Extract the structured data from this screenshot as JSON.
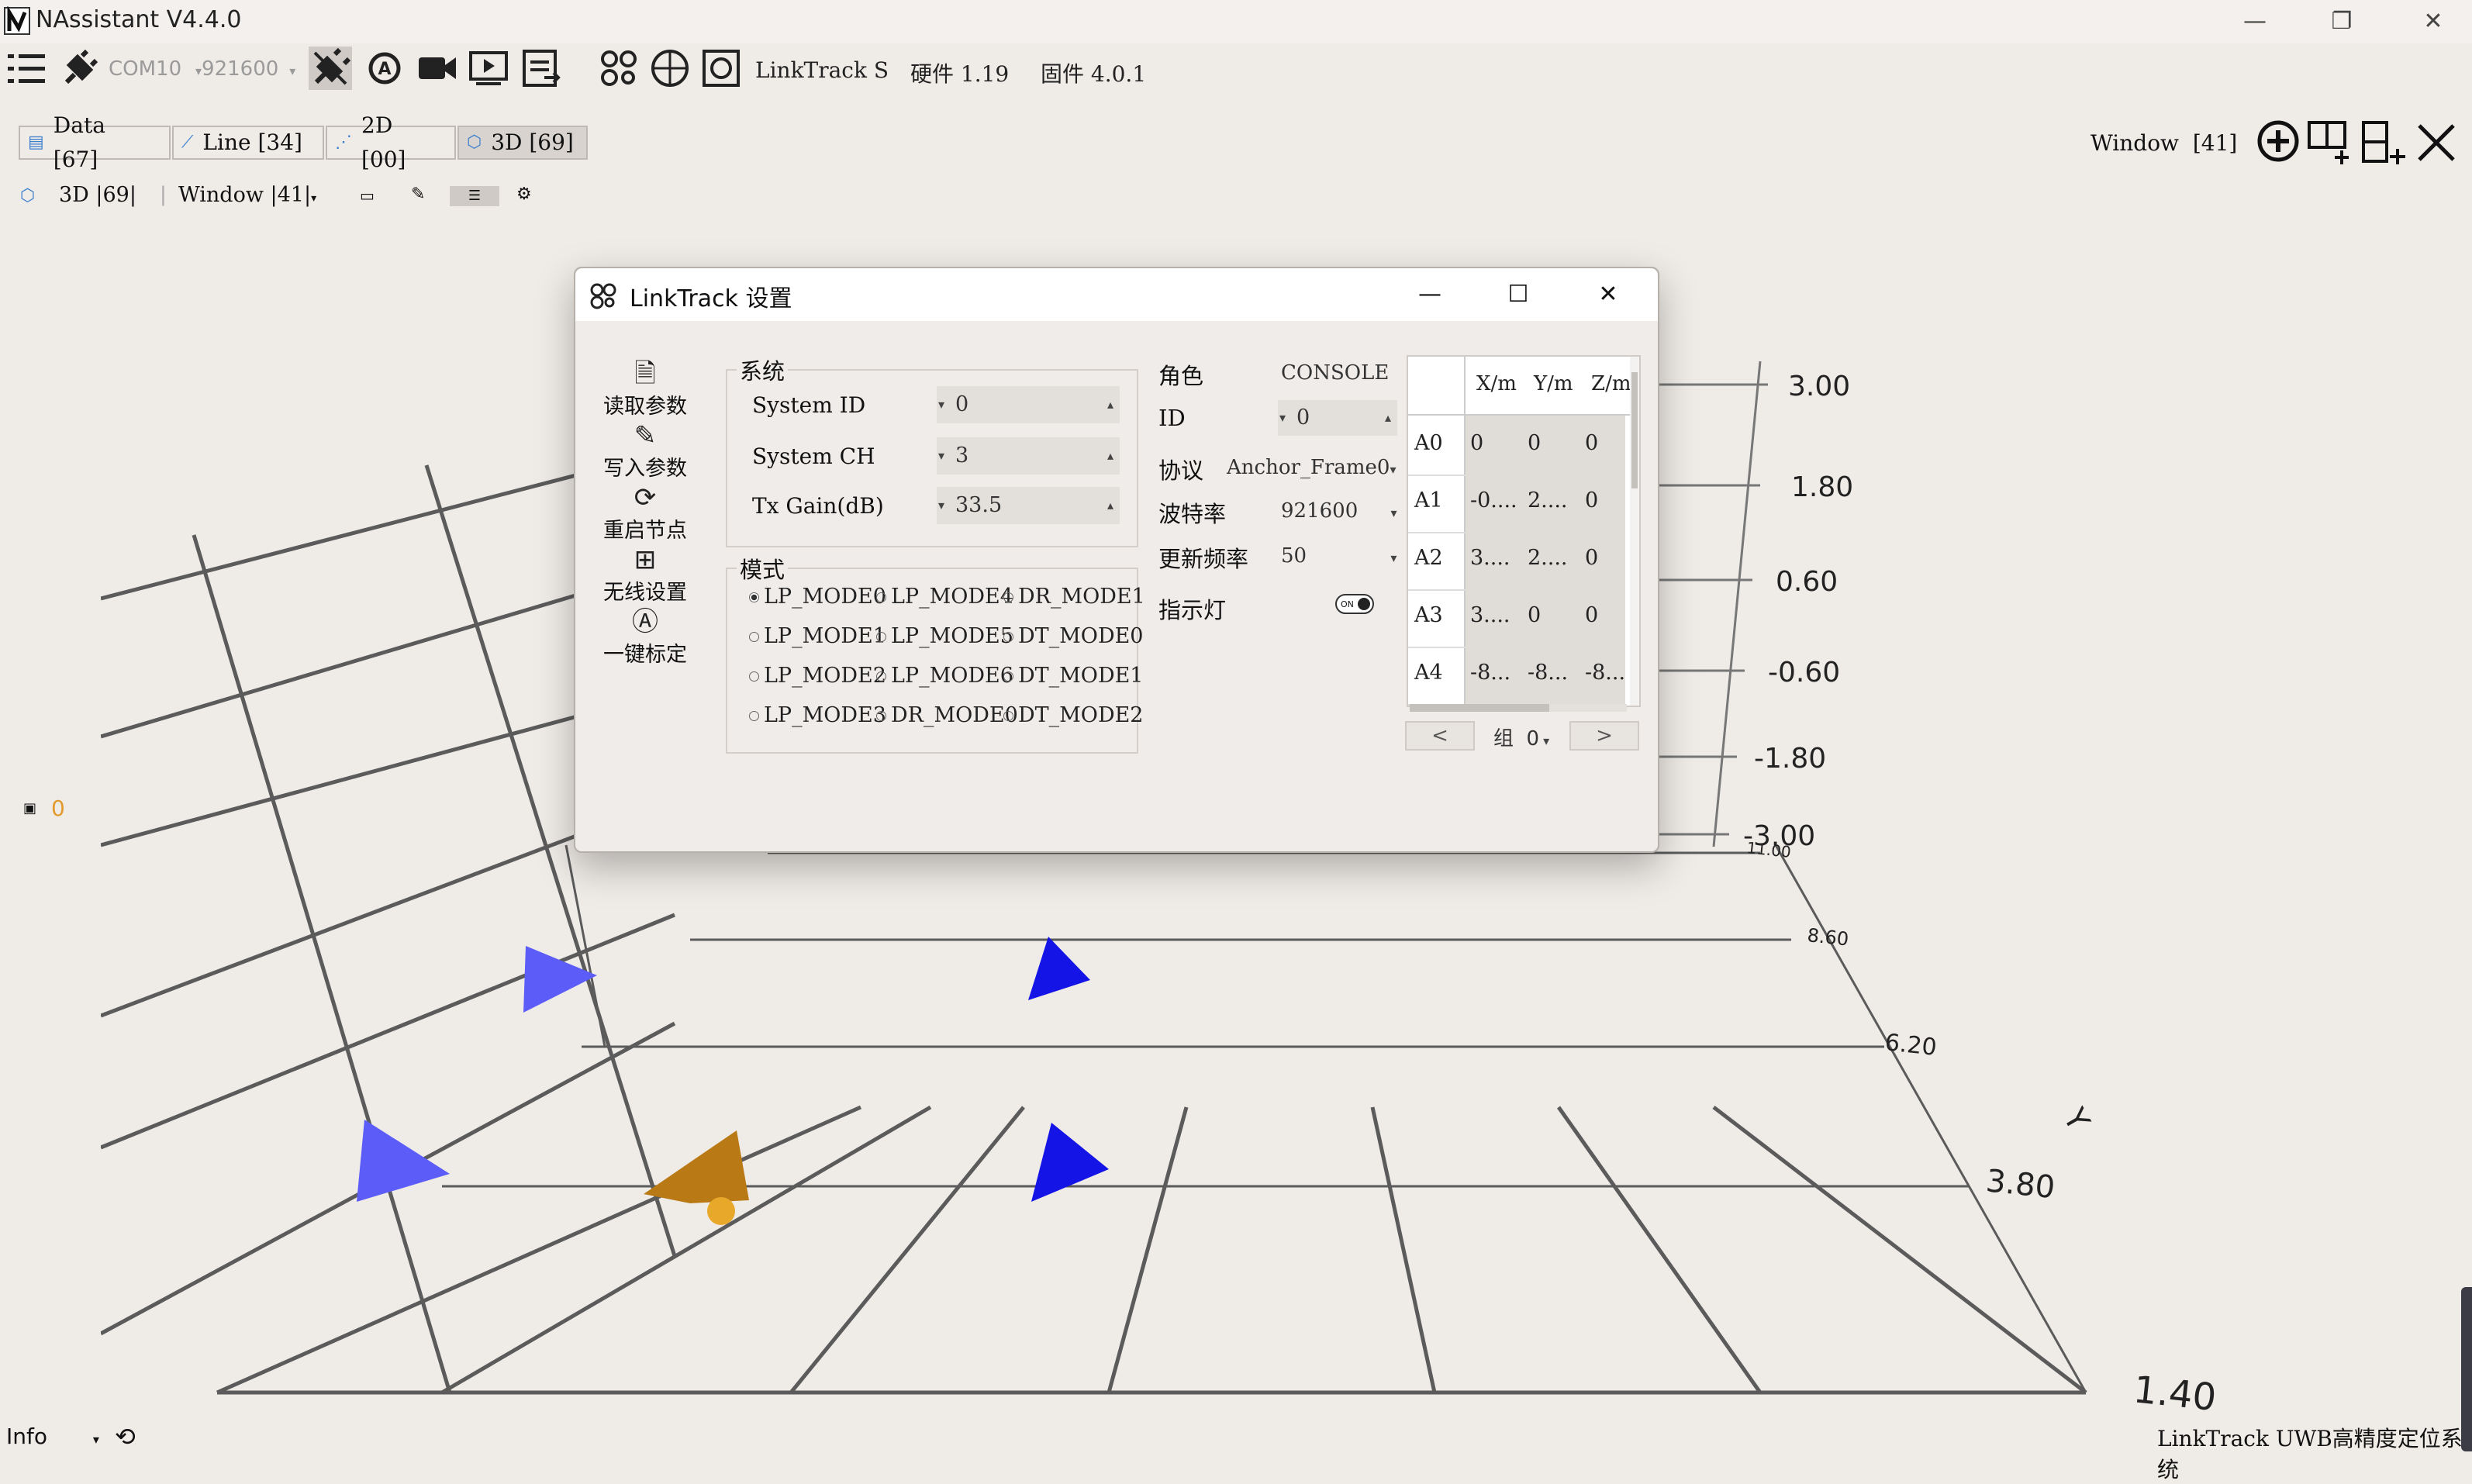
{
  "window": {
    "title": "NAssistant V4.4.0",
    "minimize": "—",
    "restore": "❐",
    "close": "✕"
  },
  "toolbar": {
    "port": "COM10",
    "baud": "921600",
    "device": "LinkTrack S",
    "hardware": "硬件 1.19",
    "firmware": "固件 4.0.1"
  },
  "tabs": [
    {
      "label": "Data [67]"
    },
    {
      "label": "Line [34]"
    },
    {
      "label": "2D [00]"
    },
    {
      "label": "3D [69]"
    }
  ],
  "window_selector": {
    "label": "Window",
    "value": "[41]"
  },
  "subtoolbar": {
    "view": "3D |69|",
    "window": "Window |41|"
  },
  "legend": {
    "tag": "0",
    "tag_color": "#e39a2e"
  },
  "plot3d": {
    "z_ticks": [
      "3.00",
      "1.80",
      "0.60",
      "-0.60",
      "-1.80",
      "-3.00"
    ],
    "y_ticks": [
      "11.00",
      "8.60",
      "6.20",
      "3.80",
      "1.40"
    ],
    "y_axis_label": "Y",
    "anchor_color": "#4a4df5",
    "tag_color": "#c8841a"
  },
  "dialog": {
    "title": "LinkTrack 设置",
    "side_menu": [
      {
        "label": "读取参数",
        "icon": "read-params-icon"
      },
      {
        "label": "写入参数",
        "icon": "write-params-icon"
      },
      {
        "label": "重启节点",
        "icon": "restart-icon"
      },
      {
        "label": "无线设置",
        "icon": "network-icon"
      },
      {
        "label": "一键标定",
        "icon": "calibrate-icon"
      }
    ],
    "system": {
      "title": "系统",
      "fields": [
        {
          "label": "System ID",
          "value": "0"
        },
        {
          "label": "System CH",
          "value": "3"
        },
        {
          "label": "Tx Gain(dB)",
          "value": "33.5"
        }
      ]
    },
    "mode": {
      "title": "模式",
      "options": [
        "LP_MODE0",
        "LP_MODE4",
        "DR_MODE1",
        "LP_MODE1",
        "LP_MODE5",
        "DT_MODE0",
        "LP_MODE2",
        "LP_MODE6",
        "DT_MODE1",
        "LP_MODE3",
        "DR_MODE0",
        "DT_MODE2"
      ],
      "selected": "LP_MODE0"
    },
    "settings": {
      "role_label": "角色",
      "role_value": "CONSOLE",
      "id_label": "ID",
      "id_value": "0",
      "protocol_label": "协议",
      "protocol_value": "Anchor_Frame0",
      "baud_label": "波特率",
      "baud_value": "921600",
      "rate_label": "更新频率",
      "rate_value": "50",
      "led_label": "指示灯",
      "led_state": "ON"
    },
    "anchors": {
      "columns": [
        "X/m",
        "Y/m",
        "Z/m"
      ],
      "rows": [
        {
          "name": "A0",
          "x": "0",
          "y": "0",
          "z": "0"
        },
        {
          "name": "A1",
          "x": "-0....",
          "y": "2....",
          "z": "0"
        },
        {
          "name": "A2",
          "x": "3....",
          "y": "2....",
          "z": "0"
        },
        {
          "name": "A3",
          "x": "3....",
          "y": "0",
          "z": "0"
        },
        {
          "name": "A4",
          "x": "-8...",
          "y": "-8...",
          "z": "-8..."
        }
      ],
      "group_label": "组",
      "group_value": "0",
      "prev": "<",
      "next": ">"
    }
  },
  "status": {
    "level": "Info",
    "right_text": "LinkTrack UWB高精度定位系统"
  }
}
